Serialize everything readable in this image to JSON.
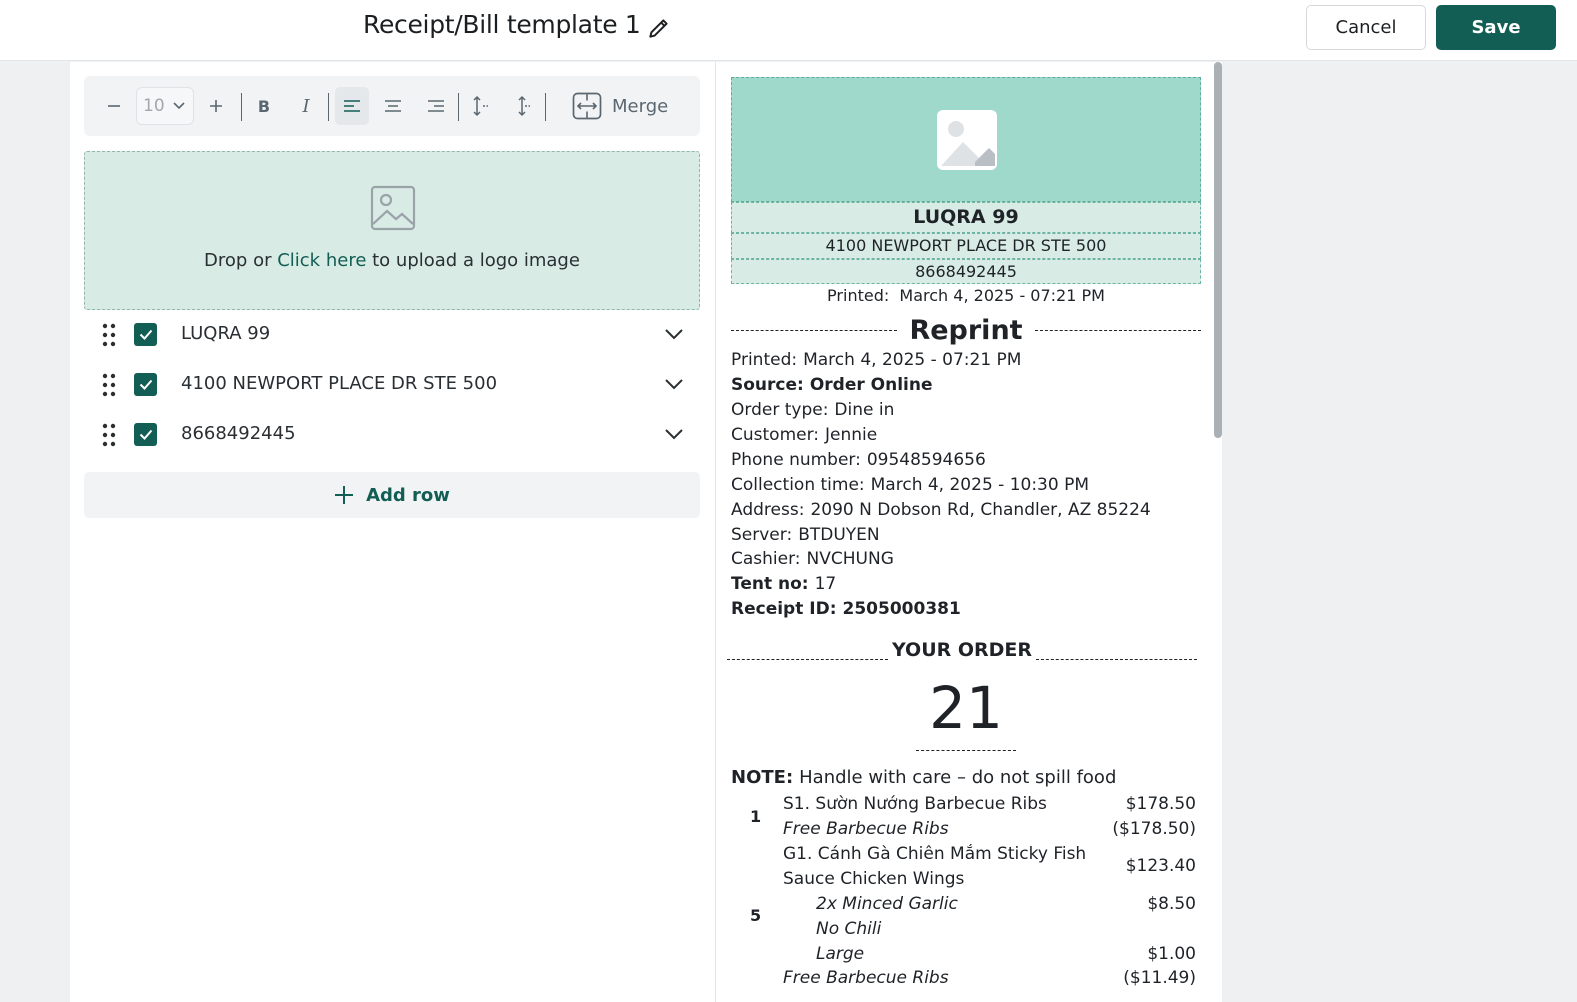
{
  "header": {
    "title": "Receipt/Bill template 1",
    "cancel_label": "Cancel",
    "save_label": "Save"
  },
  "toolbar": {
    "font_size": "10",
    "bold_label": "B",
    "italic_label": "I",
    "merge_label": "Merge"
  },
  "dropzone": {
    "text_before": "Drop or ",
    "link": "Click here",
    "text_after": " to upload a logo image"
  },
  "rows": [
    {
      "label": "LUQRA 99",
      "checked": true
    },
    {
      "label": "4100 NEWPORT PLACE DR STE 500",
      "checked": true
    },
    {
      "label": "8668492445",
      "checked": true
    }
  ],
  "add_row_label": "Add row",
  "receipt": {
    "store_name": "LUQRA 99",
    "address": "4100 NEWPORT PLACE DR STE 500",
    "phone": "8668492445",
    "printed_top": {
      "key": "Printed:",
      "value": "March 4, 2025 - 07:21 PM"
    },
    "reprint": "Reprint",
    "fields": [
      {
        "key": "Printed:",
        "value": "March 4, 2025 - 07:21 PM",
        "bold": false
      },
      {
        "key": "Source:",
        "value": "Order Online",
        "bold": true
      },
      {
        "key": "Order type:",
        "value": "Dine in",
        "bold": false
      },
      {
        "key": "Customer:",
        "value": "Jennie",
        "bold": false
      },
      {
        "key": "Phone number:",
        "value": "09548594656",
        "bold": false
      },
      {
        "key": "Collection time:",
        "value": "March 4, 2025 - 10:30 PM",
        "bold": false
      },
      {
        "key": "Address:",
        "value": "2090 N Dobson Rd, Chandler, AZ 85224",
        "bold": false
      },
      {
        "key": "Server:",
        "value": "BTDUYEN",
        "bold": false
      },
      {
        "key": "Cashier:",
        "value": "NVCHUNG",
        "bold": false
      },
      {
        "key": "Tent no:",
        "value": "17",
        "bold": "key"
      },
      {
        "key": "Receipt ID:",
        "value": "2505000381",
        "bold": true
      }
    ],
    "your_order": "YOUR ORDER",
    "order_number": "21",
    "note_key": "NOTE:",
    "note_value": "Handle with care – do not spill food",
    "items": [
      {
        "qty": "1",
        "name": "S1. Sườn Nướng Barbecue Ribs",
        "price": "$178.50",
        "discount_label": "Free Barbecue Ribs",
        "discount": "($178.50)"
      },
      {
        "qty": "5",
        "name_line1": "G1. Cánh Gà Chiên Mắm Sticky Fish",
        "name_line2": "Sauce Chicken Wings",
        "price": "$123.40",
        "mod1": "2x Minced Garlic",
        "mod1_price": "$8.50",
        "mod2": "No Chili",
        "mod3": "Large",
        "mod3_price": "$1.00",
        "discount_label": "Free Barbecue Ribs",
        "discount": "($11.49)"
      }
    ]
  }
}
